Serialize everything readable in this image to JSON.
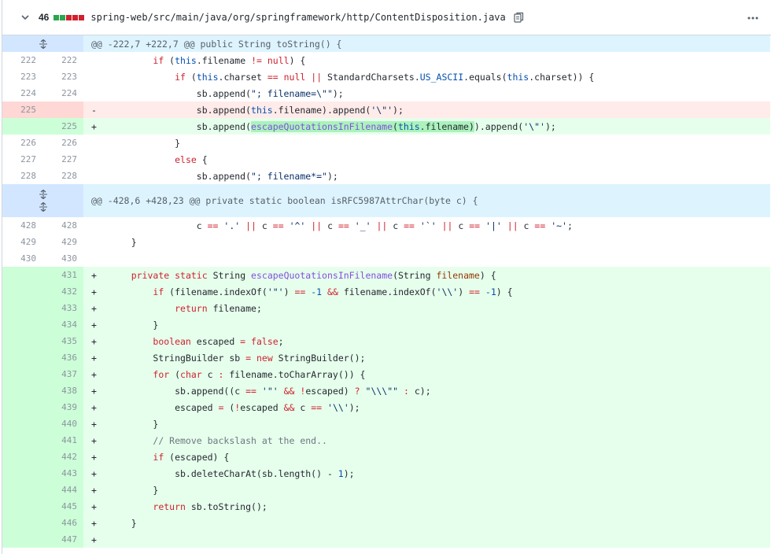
{
  "file": {
    "changes_count": "46",
    "path": "spring-web/src/main/java/org/springframework/http/ContentDisposition.java",
    "diffstat_colors": [
      "#2da44e",
      "#2da44e",
      "#cf222e",
      "#cf222e",
      "#cf222e"
    ]
  },
  "hunks": [
    {
      "header": "@@ -222,7 +222,7 @@ public String toString() {"
    },
    {
      "header": "@@ -428,6 +428,23 @@ private static boolean isRFC5987AttrChar(byte c) {"
    }
  ],
  "lines": [
    {
      "old": "222",
      "new": "222",
      "sign": " ",
      "type": "ctx",
      "code": "        if (this.filename != null) {"
    },
    {
      "old": "223",
      "new": "223",
      "sign": " ",
      "type": "ctx",
      "code": "            if (this.charset == null || StandardCharsets.US_ASCII.equals(this.charset)) {"
    },
    {
      "old": "224",
      "new": "224",
      "sign": " ",
      "type": "ctx",
      "code": "                sb.append(\"; filename=\\\"\");"
    },
    {
      "old": "225",
      "new": "",
      "sign": "-",
      "type": "del",
      "code": "                sb.append(this.filename).append('\\\"');"
    },
    {
      "old": "",
      "new": "225",
      "sign": "+",
      "type": "add",
      "code": "                sb.append(escapeQuotationsInFilename(this.filename)).append('\\\"');"
    },
    {
      "old": "226",
      "new": "226",
      "sign": " ",
      "type": "ctx",
      "code": "            }"
    },
    {
      "old": "227",
      "new": "227",
      "sign": " ",
      "type": "ctx",
      "code": "            else {"
    },
    {
      "old": "228",
      "new": "228",
      "sign": " ",
      "type": "ctx",
      "code": "                sb.append(\"; filename*=\");"
    },
    {
      "old": "428",
      "new": "428",
      "sign": " ",
      "type": "ctx",
      "code": "                c == '.' || c == '^' || c == '_' || c == '`' || c == '|' || c == '~';"
    },
    {
      "old": "429",
      "new": "429",
      "sign": " ",
      "type": "ctx",
      "code": "    }"
    },
    {
      "old": "430",
      "new": "430",
      "sign": " ",
      "type": "ctx",
      "code": ""
    },
    {
      "old": "",
      "new": "431",
      "sign": "+",
      "type": "add",
      "code": "    private static String escapeQuotationsInFilename(String filename) {"
    },
    {
      "old": "",
      "new": "432",
      "sign": "+",
      "type": "add",
      "code": "        if (filename.indexOf('\"') == -1 && filename.indexOf('\\\\') == -1) {"
    },
    {
      "old": "",
      "new": "433",
      "sign": "+",
      "type": "add",
      "code": "            return filename;"
    },
    {
      "old": "",
      "new": "434",
      "sign": "+",
      "type": "add",
      "code": "        }"
    },
    {
      "old": "",
      "new": "435",
      "sign": "+",
      "type": "add",
      "code": "        boolean escaped = false;"
    },
    {
      "old": "",
      "new": "436",
      "sign": "+",
      "type": "add",
      "code": "        StringBuilder sb = new StringBuilder();"
    },
    {
      "old": "",
      "new": "437",
      "sign": "+",
      "type": "add",
      "code": "        for (char c : filename.toCharArray()) {"
    },
    {
      "old": "",
      "new": "438",
      "sign": "+",
      "type": "add",
      "code": "            sb.append((c == '\"' && !escaped) ? \"\\\\\\\"\" : c);"
    },
    {
      "old": "",
      "new": "439",
      "sign": "+",
      "type": "add",
      "code": "            escaped = (!escaped && c == '\\\\');"
    },
    {
      "old": "",
      "new": "440",
      "sign": "+",
      "type": "add",
      "code": "        }"
    },
    {
      "old": "",
      "new": "441",
      "sign": "+",
      "type": "add",
      "code": "        // Remove backslash at the end.."
    },
    {
      "old": "",
      "new": "442",
      "sign": "+",
      "type": "add",
      "code": "        if (escaped) {"
    },
    {
      "old": "",
      "new": "443",
      "sign": "+",
      "type": "add",
      "code": "            sb.deleteCharAt(sb.length() - 1);"
    },
    {
      "old": "",
      "new": "444",
      "sign": "+",
      "type": "add",
      "code": "        }"
    },
    {
      "old": "",
      "new": "445",
      "sign": "+",
      "type": "add",
      "code": "        return sb.toString();"
    },
    {
      "old": "",
      "new": "446",
      "sign": "+",
      "type": "add",
      "code": "    }"
    },
    {
      "old": "",
      "new": "447",
      "sign": "+",
      "type": "add",
      "code": ""
    }
  ]
}
